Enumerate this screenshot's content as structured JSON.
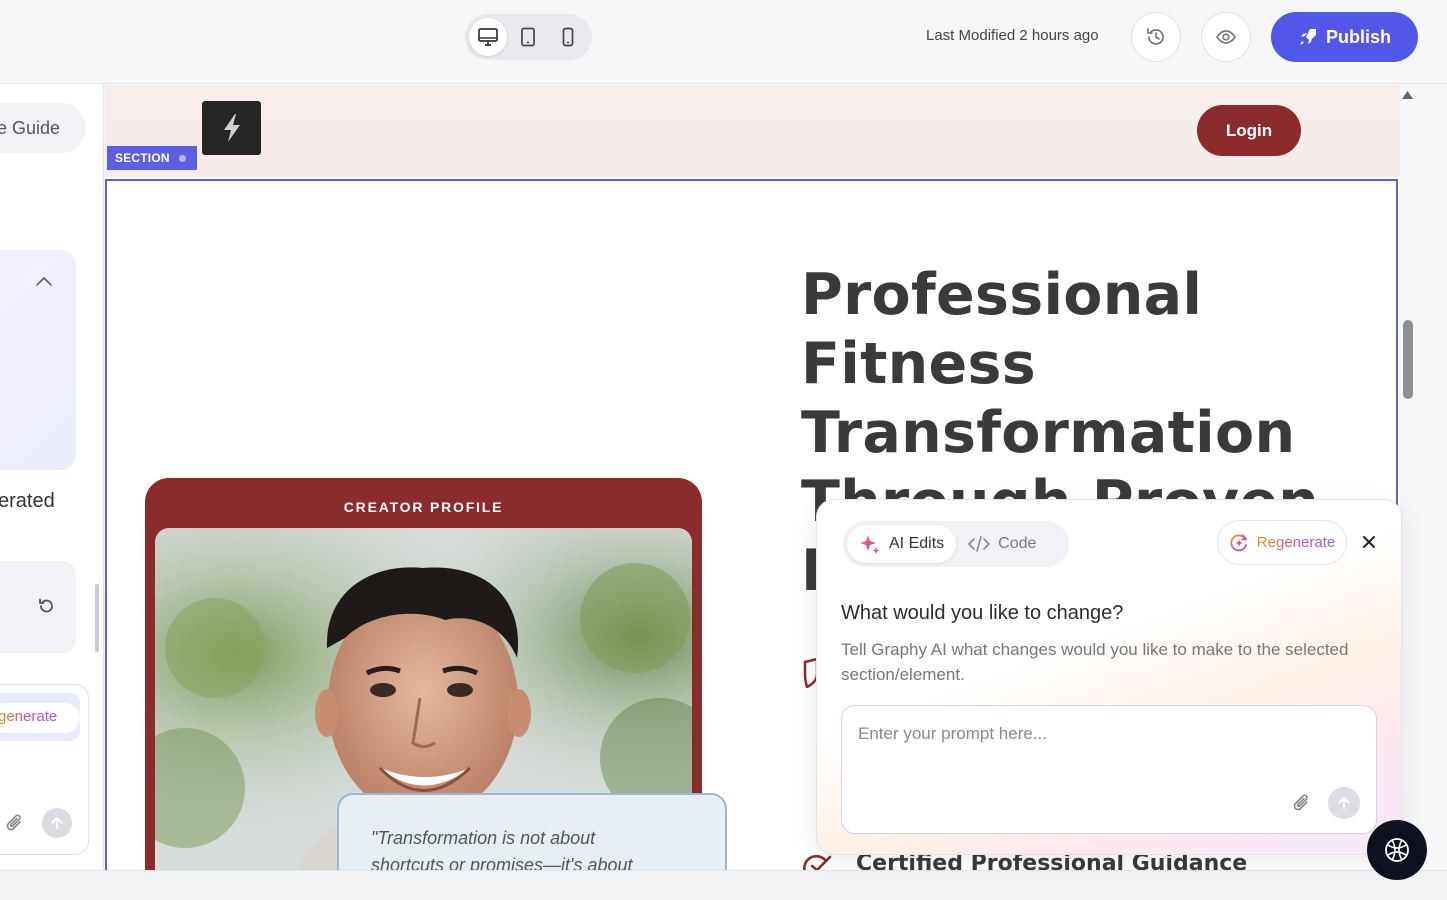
{
  "topbar": {
    "devices": [
      {
        "name": "desktop",
        "active": true
      },
      {
        "name": "tablet",
        "active": false
      },
      {
        "name": "mobile",
        "active": false
      }
    ],
    "last_modified": "Last Modified 2 hours ago",
    "publish_label": "Publish",
    "accent": "#5357e8"
  },
  "left_panel": {
    "guide_label": "e Guide",
    "generated_label": "erated",
    "regenerate_label": "generate"
  },
  "canvas": {
    "section_tag": "SECTION",
    "login_label": "Login",
    "hero_title_lines": [
      "Professional",
      "Fitness",
      "Transformation",
      "Through Proven",
      "M"
    ],
    "profile_label": "CREATOR PROFILE",
    "quote_lines": [
      "\"Transformation is not about",
      "shortcuts or promises—it's about"
    ],
    "cert_text": "Certified Professional Guidance",
    "brand_color": "#8b2b2b"
  },
  "ai_panel": {
    "tabs": [
      {
        "label": "AI Edits",
        "icon": "sparkle-icon",
        "active": true
      },
      {
        "label": "Code",
        "icon": "code-icon",
        "active": false
      }
    ],
    "regenerate_label": "Regenerate",
    "heading": "What would you like to change?",
    "description": "Tell Graphy AI what changes would you like to make to the selected section/element.",
    "prompt_placeholder": "Enter your prompt here...",
    "prompt_value": ""
  }
}
